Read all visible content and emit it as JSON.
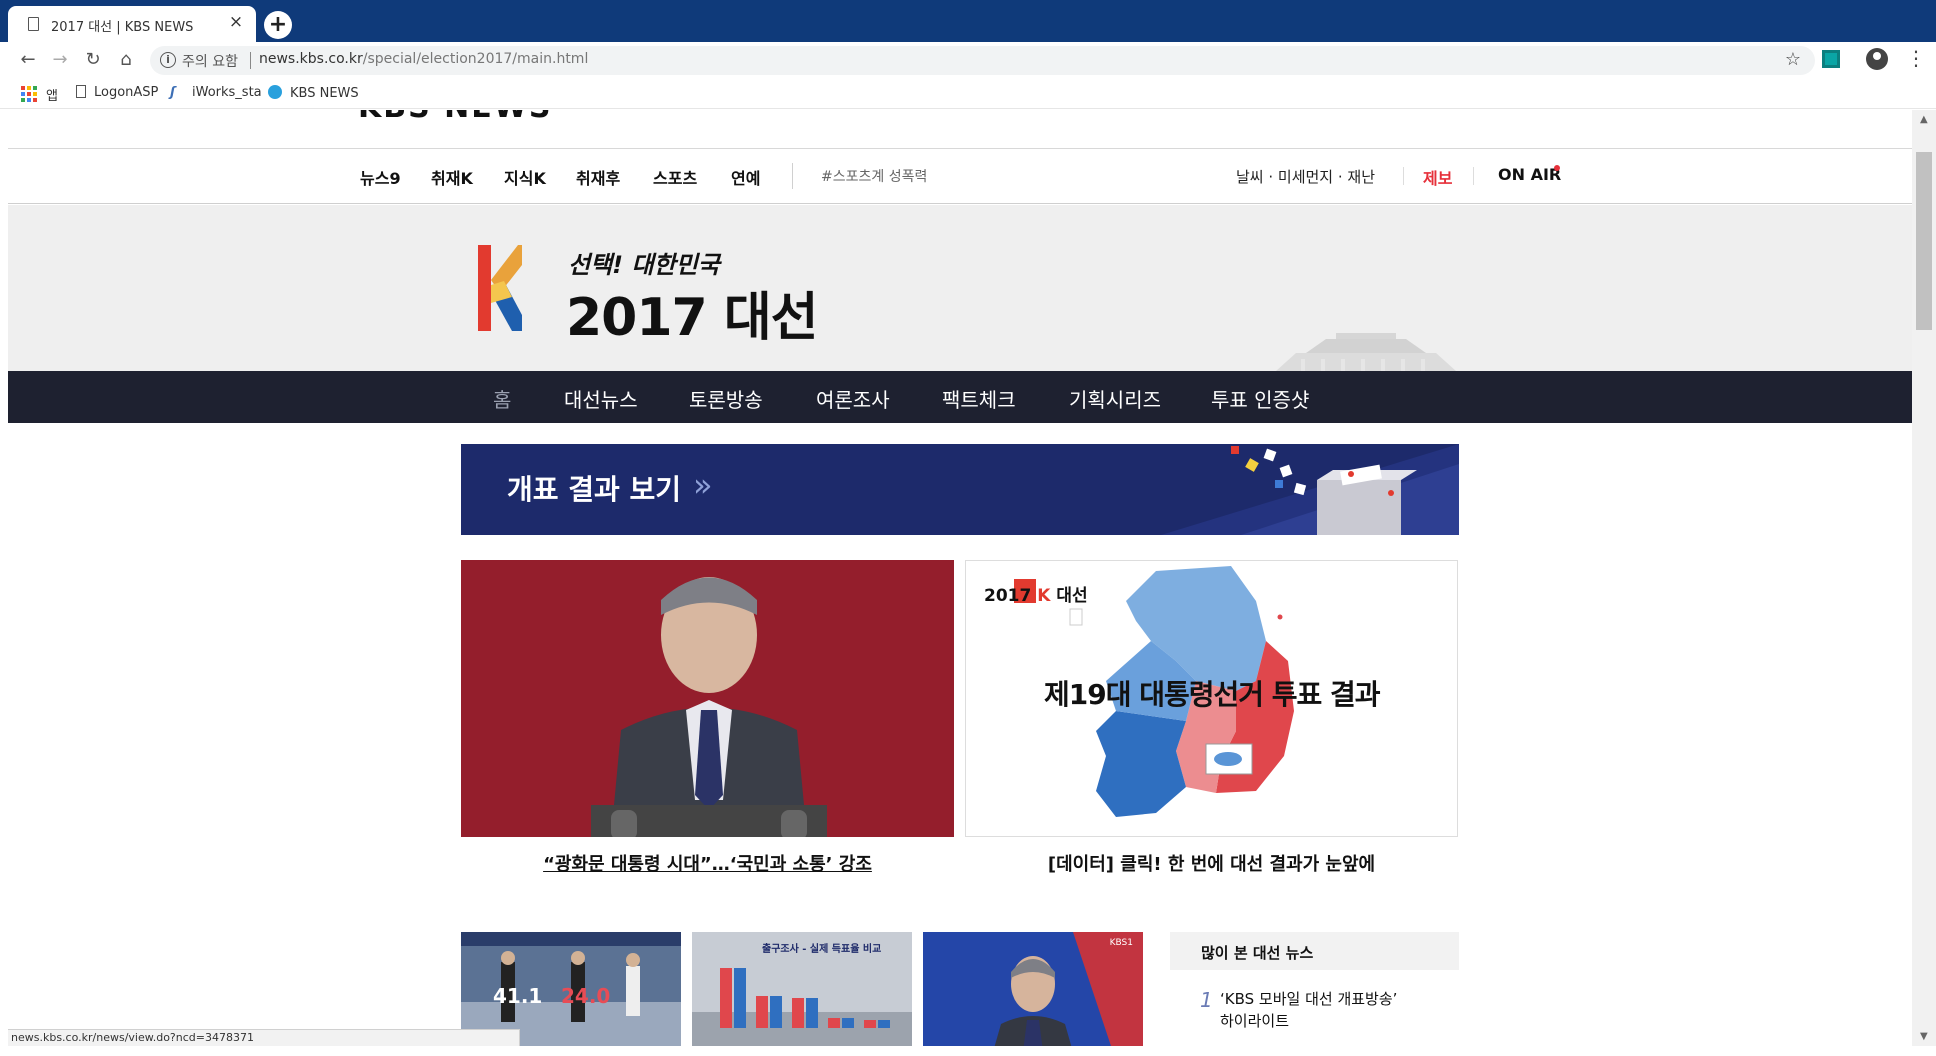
{
  "browser": {
    "tab_title": "2017 대선 | KBS NEWS",
    "tab_close": "×",
    "new_tab": "+",
    "security_label": "주의 요함",
    "url_host": "news.kbs.co.kr",
    "url_path": "/special/election2017/main.html",
    "bookmarks": {
      "apps": "앱",
      "items": [
        "LogonASP",
        "iWorks_sta",
        "KBS NEWS"
      ]
    },
    "status_url": "news.kbs.co.kr/news/view.do?ncd=3478371"
  },
  "page": {
    "logo_fragment": "KBS NEWS",
    "gnb": {
      "items": [
        "뉴스9",
        "취재K",
        "지식K",
        "취재후",
        "스포츠",
        "연예"
      ],
      "hashtag": "#스포츠계 성폭력",
      "weather": "날씨 · 미세먼지 · 재난",
      "tip": "제보",
      "onair": "ON AIR"
    },
    "hero": {
      "slogan": "선택! 대한민국",
      "title": "2017 대선"
    },
    "subnav": [
      "홈",
      "대선뉴스",
      "토론방송",
      "여론조사",
      "팩트체크",
      "기획시리즈",
      "투표 인증샷"
    ],
    "banner": {
      "text": "개표 결과 보기",
      "chevron": "»"
    },
    "featured": [
      {
        "caption": "“광화문 대통령 시대”…‘국민과 소통’ 강조"
      },
      {
        "caption": "[데이터] 클릭! 한 번에 대선 결과가 눈앞에",
        "brand_year": "2017",
        "brand_word": "대선",
        "image_title": "제19대 대통령선거 투표 결과"
      }
    ],
    "thumbnails": [
      {
        "badge1": "41.1",
        "badge2": "24.0"
      },
      {
        "title": "출구조사 - 실제 득표율 비교"
      },
      {
        "corner": "KBS1"
      }
    ],
    "popular": {
      "header": "많이 본 대선 뉴스",
      "rank": "1",
      "line1": "‘KBS 모바일 대선 개표방송’",
      "line2": "하이라이트"
    }
  },
  "colors": {
    "chrome_tab_bar": "#0f3a7a",
    "subnav_bg": "#1e2130",
    "banner_bg": "#1d2a6b",
    "accent_red": "#e6303a",
    "map_blue": "#2f6fc0",
    "map_red": "#e0474c"
  }
}
